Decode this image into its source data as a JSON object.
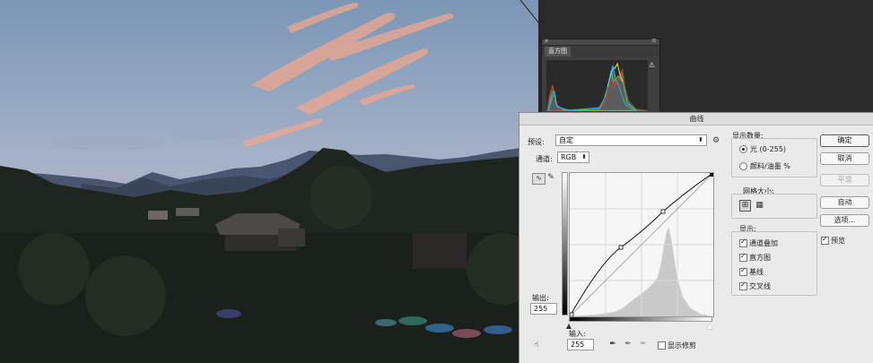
{
  "colors": {
    "sky_top": "#7d98b6",
    "sky_mid": "#a9b2c6",
    "sky_horizon": "#c9b3bc",
    "cloud": "#f0a88e",
    "mountains": "#45506a",
    "foreground": "#1d231d",
    "panel_dark": "#2b2b2b",
    "dialog_bg": "#eaeaea"
  },
  "histogram_panel": {
    "tab_label": "直方图",
    "warning_icon": "warning-icon"
  },
  "curves_dialog": {
    "title": "曲线",
    "preset": {
      "label": "预设:",
      "value": "自定"
    },
    "channel": {
      "label": "通道:",
      "value": "RGB"
    },
    "output": {
      "label": "输出:",
      "value": "255"
    },
    "input": {
      "label": "输入:",
      "value": "255"
    },
    "show_clipping": {
      "label": "显示修剪",
      "checked": false
    },
    "display_amount": {
      "title": "显示数量:",
      "options": [
        {
          "label": "光 (0-255)",
          "selected": true
        },
        {
          "label": "颜料/油墨 %",
          "selected": false
        }
      ]
    },
    "grid_size": {
      "title": "网格大小:"
    },
    "show": {
      "title": "显示:",
      "options": [
        {
          "label": "通道叠加",
          "checked": true
        },
        {
          "label": "直方图",
          "checked": true
        },
        {
          "label": "基线",
          "checked": true
        },
        {
          "label": "交叉线",
          "checked": true
        }
      ]
    },
    "buttons": {
      "ok": "确定",
      "cancel": "取消",
      "smooth": "平滑",
      "auto": "自动",
      "options": "选项..."
    },
    "preview": {
      "label": "预览",
      "checked": true
    },
    "curve_points": [
      {
        "input": 0,
        "output": 0
      },
      {
        "input": 91,
        "output": 108
      },
      {
        "input": 165,
        "output": 196
      },
      {
        "input": 255,
        "output": 255
      }
    ]
  }
}
